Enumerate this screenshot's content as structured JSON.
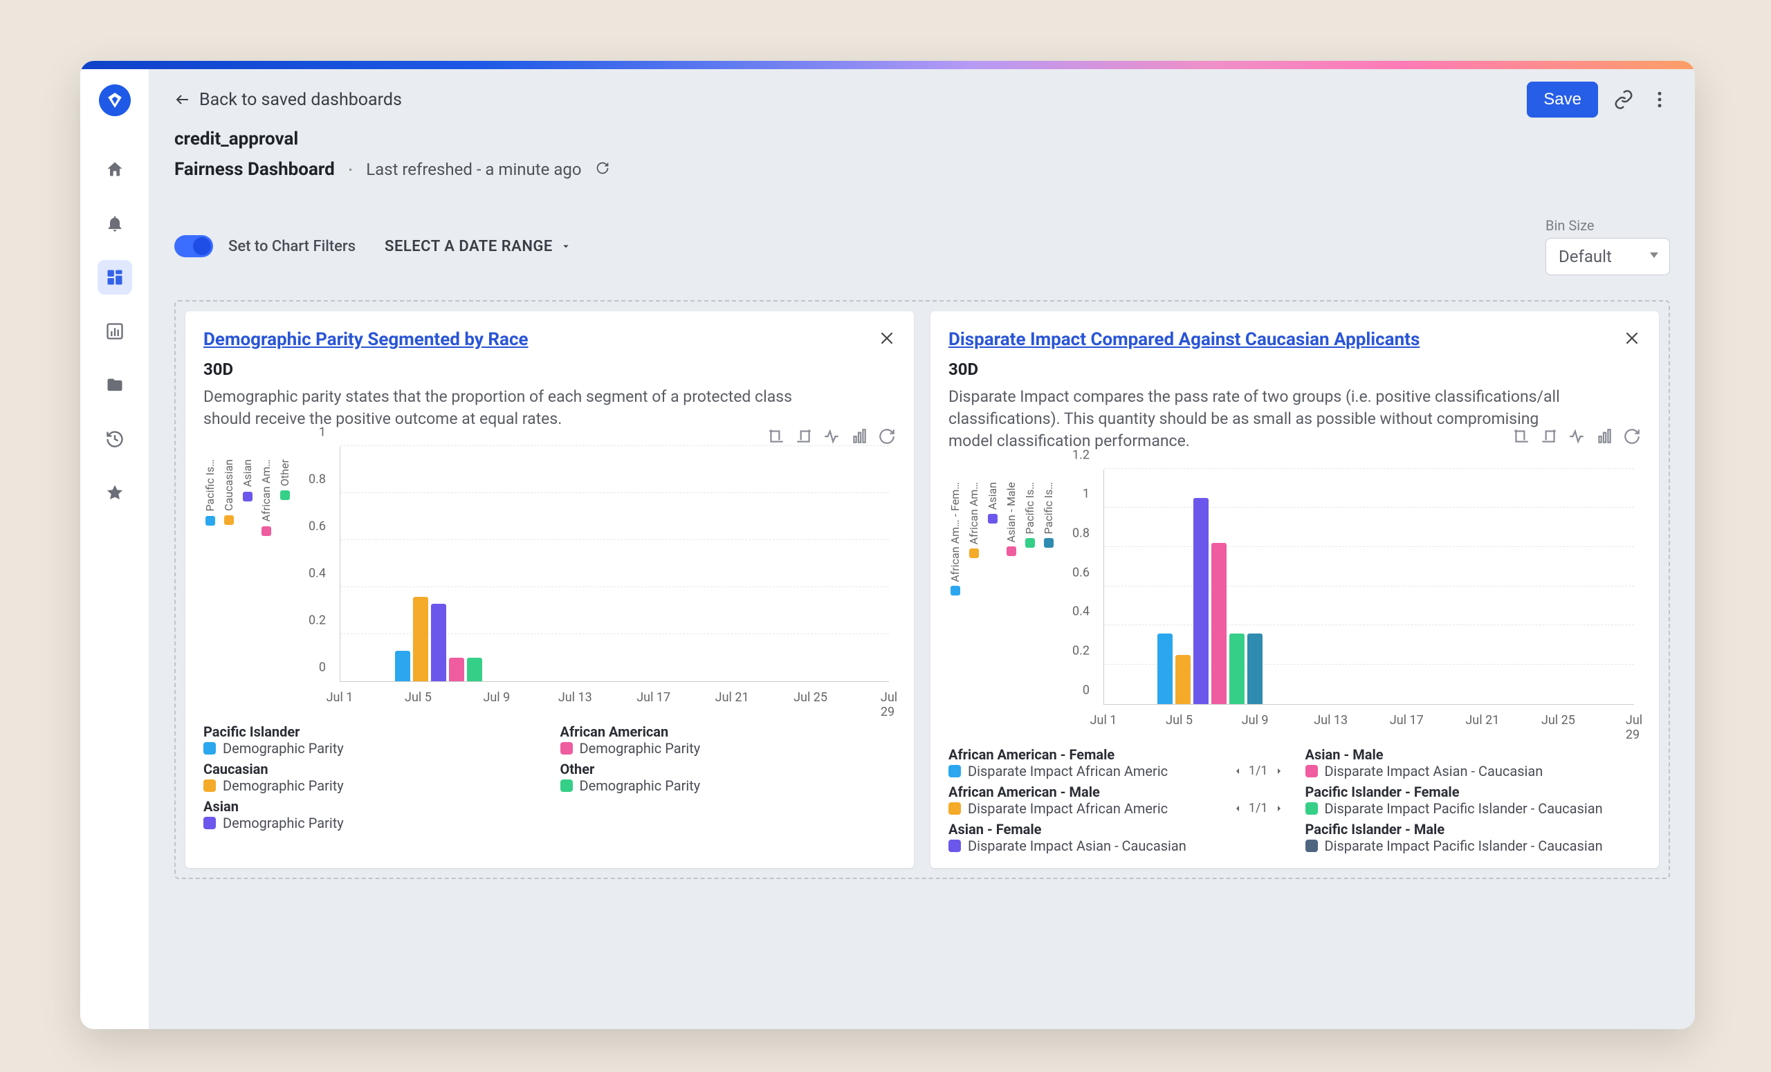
{
  "header": {
    "back_label": "Back to saved dashboards",
    "save_label": "Save",
    "breadcrumb": "credit_approval",
    "title": "Fairness Dashboard",
    "separator": "•",
    "refreshed": "Last refreshed - a minute ago"
  },
  "filters": {
    "toggle_label": "Set to Chart Filters",
    "date_range_label": "SELECT A DATE RANGE",
    "bin_label": "Bin Size",
    "bin_value": "Default"
  },
  "card1": {
    "title": "Demographic Parity Segmented by Race",
    "range": "30D",
    "desc": "Demographic parity states that the proportion of each segment of a protected class should receive the positive outcome at equal rates.",
    "legend": {
      "h1": "Pacific Islander",
      "l1": "Demographic Parity",
      "h2": "African American",
      "l2": "Demographic Parity",
      "h3": "Caucasian",
      "l3": "Demographic Parity",
      "h4": "Other",
      "l4": "Demographic Parity",
      "h5": "Asian",
      "l5": "Demographic Parity"
    }
  },
  "card2": {
    "title": "Disparate Impact Compared Against Caucasian Applicants",
    "range": "30D",
    "desc": "Disparate Impact compares the pass rate of two groups (i.e. positive classifications/all classifications). This quantity should be as small as possible without compromising model classification performance.",
    "legend": {
      "h1": "African American - Female",
      "l1": "Disparate Impact African Americ",
      "h2": "Asian - Male",
      "l2": "Disparate Impact Asian - Caucasian",
      "h3": "African American - Male",
      "l3": "Disparate Impact African Americ",
      "h4": "Pacific Islander - Female",
      "l4": "Disparate Impact Pacific Islander - Caucasian",
      "h5": "Asian - Female",
      "l5": "Disparate Impact Asian - Caucasian",
      "h6": "Pacific Islander - Male",
      "l6": "Disparate Impact Pacific Islander - Caucasian"
    },
    "pager": "1/1"
  },
  "chart_data": [
    {
      "type": "bar",
      "title": "Demographic Parity Segmented by Race",
      "ylim": [
        0,
        1
      ],
      "yticks": [
        0,
        0.2,
        0.4,
        0.6,
        0.8,
        1
      ],
      "xticks": [
        "Jul 1",
        "Jul 5",
        "Jul 9",
        "Jul 13",
        "Jul 17",
        "Jul 21",
        "Jul 25",
        "Jul 29"
      ],
      "cluster_x": "Jul 8",
      "series": [
        {
          "name": "Pacific Islander",
          "color": "#2aa7ee",
          "value": 0.13
        },
        {
          "name": "Caucasian",
          "color": "#f5aa2a",
          "value": 0.36
        },
        {
          "name": "Asian",
          "color": "#6b57eb",
          "value": 0.33
        },
        {
          "name": "African American",
          "color": "#ef5c9f",
          "value": 0.1
        },
        {
          "name": "Other",
          "color": "#36cf87",
          "value": 0.1
        }
      ],
      "y_legend": [
        {
          "label": "Pacific Is…",
          "color": "#2aa7ee"
        },
        {
          "label": "Caucasian",
          "color": "#f5aa2a"
        },
        {
          "label": "Asian",
          "color": "#6b57eb"
        },
        {
          "label": "African Am…",
          "color": "#ef5c9f"
        },
        {
          "label": "Other",
          "color": "#36cf87"
        }
      ]
    },
    {
      "type": "bar",
      "title": "Disparate Impact Compared Against Caucasian Applicants",
      "ylim": [
        0,
        1.2
      ],
      "yticks": [
        0,
        0.2,
        0.4,
        0.6,
        0.8,
        1,
        1.2
      ],
      "xticks": [
        "Jul 1",
        "Jul 5",
        "Jul 9",
        "Jul 13",
        "Jul 17",
        "Jul 21",
        "Jul 25",
        "Jul 29"
      ],
      "cluster_x": "Jul 8",
      "series": [
        {
          "name": "African American - Female",
          "color": "#2aa7ee",
          "value": 0.36
        },
        {
          "name": "African American - Male",
          "color": "#f5aa2a",
          "value": 0.25
        },
        {
          "name": "Asian - Female",
          "color": "#6b57eb",
          "value": 1.05
        },
        {
          "name": "Asian - Male",
          "color": "#ef5c9f",
          "value": 0.82
        },
        {
          "name": "Pacific Islander - Female",
          "color": "#36cf87",
          "value": 0.36
        },
        {
          "name": "Pacific Islander - Male",
          "color": "#2f8bb0",
          "value": 0.36
        }
      ],
      "y_legend": [
        {
          "label": "African Am… - Fem…",
          "color": "#2aa7ee"
        },
        {
          "label": "African Am…",
          "color": "#f5aa2a"
        },
        {
          "label": "Asian",
          "color": "#6b57eb"
        },
        {
          "label": "Asian - Male",
          "color": "#ef5c9f"
        },
        {
          "label": "Pacific Is…",
          "color": "#36cf87"
        },
        {
          "label": "Pacific Is…",
          "color": "#2f8bb0"
        }
      ]
    }
  ]
}
